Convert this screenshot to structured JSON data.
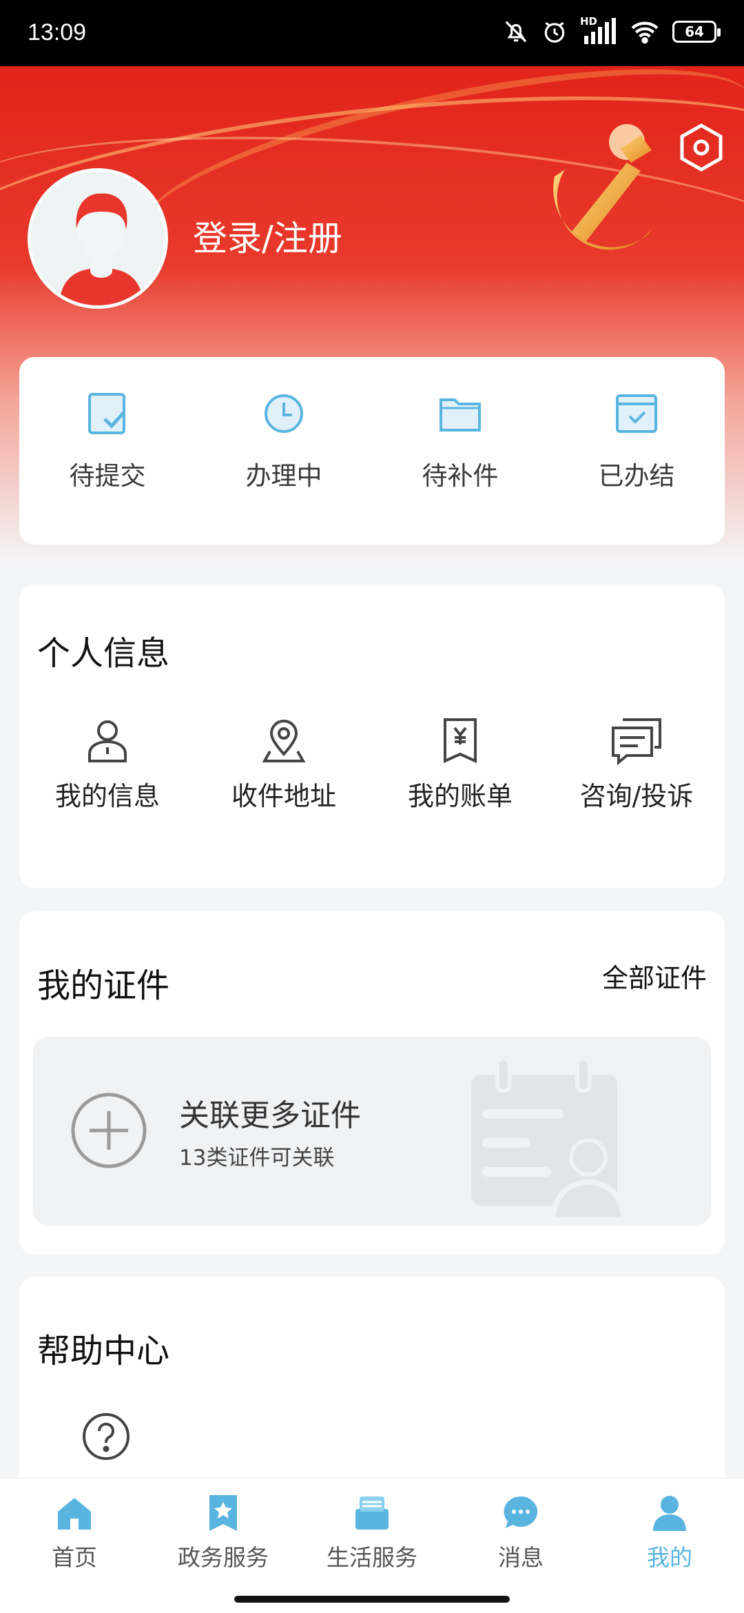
{
  "status_bar": {
    "time": "13:09",
    "battery": "64",
    "signal_label": "HD"
  },
  "header": {
    "login_label": "登录/注册"
  },
  "status_tabs": [
    {
      "label": "待提交",
      "icon": "submit-pending-icon"
    },
    {
      "label": "办理中",
      "icon": "clock-icon"
    },
    {
      "label": "待补件",
      "icon": "folder-icon"
    },
    {
      "label": "已办结",
      "icon": "completed-icon"
    }
  ],
  "personal_info": {
    "title": "个人信息",
    "items": [
      {
        "label": "我的信息",
        "icon": "user-icon"
      },
      {
        "label": "收件地址",
        "icon": "location-icon"
      },
      {
        "label": "我的账单",
        "icon": "bill-icon"
      },
      {
        "label": "咨询/投诉",
        "icon": "chat-icon"
      }
    ]
  },
  "certificates": {
    "title": "我的证件",
    "all_label": "全部证件",
    "link_title": "关联更多证件",
    "link_subtitle": "13类证件可关联"
  },
  "help": {
    "title": "帮助中心"
  },
  "bottom_nav": [
    {
      "label": "首页",
      "icon": "home-icon",
      "active": false
    },
    {
      "label": "政务服务",
      "icon": "government-service-icon",
      "active": false
    },
    {
      "label": "生活服务",
      "icon": "life-service-icon",
      "active": false
    },
    {
      "label": "消息",
      "icon": "message-icon",
      "active": false
    },
    {
      "label": "我的",
      "icon": "profile-icon",
      "active": true
    }
  ],
  "colors": {
    "hero_red": "#e2231a",
    "accent_blue": "#5ab4e0",
    "icon_blue": "#5ab4e0"
  }
}
